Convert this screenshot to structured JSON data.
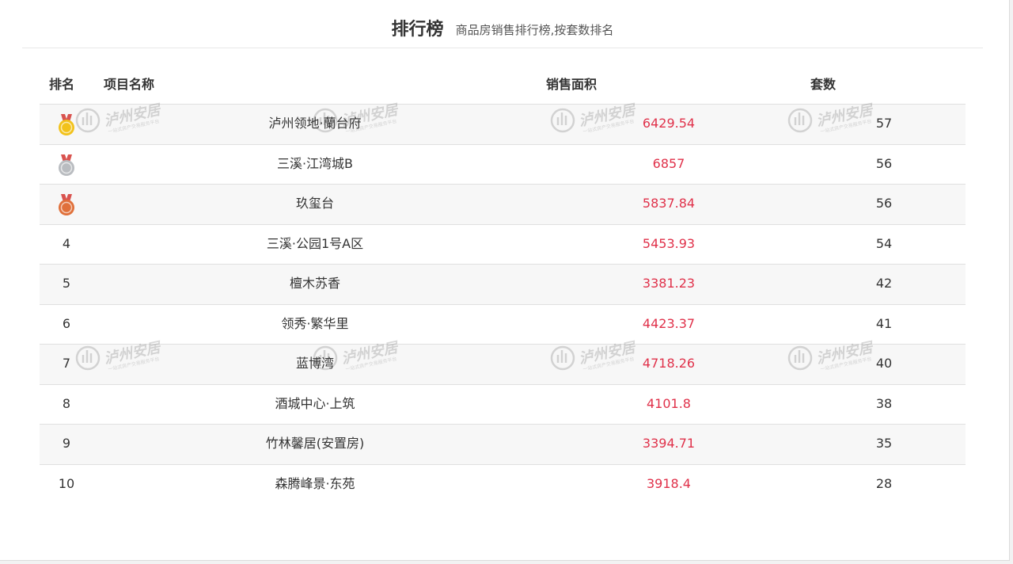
{
  "header": {
    "title": "排行榜",
    "subtitle": "商品房销售排行榜,按套数排名"
  },
  "columns": {
    "rank": "排名",
    "name": "项目名称",
    "area": "销售面积",
    "count": "套数"
  },
  "rows": [
    {
      "rank": "1",
      "medal": "gold-medal-icon",
      "name": "泸州领地·蘭台府",
      "area": "6429.54",
      "count": "57"
    },
    {
      "rank": "2",
      "medal": "silver-medal-icon",
      "name": "三溪·江湾城B",
      "area": "6857",
      "count": "56"
    },
    {
      "rank": "3",
      "medal": "bronze-medal-icon",
      "name": "玖玺台",
      "area": "5837.84",
      "count": "56"
    },
    {
      "rank": "4",
      "name": "三溪·公园1号A区",
      "area": "5453.93",
      "count": "54"
    },
    {
      "rank": "5",
      "name": "檀木苏香",
      "area": "3381.23",
      "count": "42"
    },
    {
      "rank": "6",
      "name": "领秀·繁华里",
      "area": "4423.37",
      "count": "41"
    },
    {
      "rank": "7",
      "name": "蓝博湾",
      "area": "4718.26",
      "count": "40"
    },
    {
      "rank": "8",
      "name": "酒城中心·上筑",
      "area": "4101.8",
      "count": "38"
    },
    {
      "rank": "9",
      "name": "竹林馨居(安置房)",
      "area": "3394.71",
      "count": "35"
    },
    {
      "rank": "10",
      "name": "森腾峰景·东苑",
      "area": "3918.4",
      "count": "28"
    }
  ],
  "watermark": {
    "text": "泸州安居",
    "tagline": "一站式房产交易服务平台"
  },
  "colors": {
    "area_text": "#e0314a",
    "gold": "#f2c21b",
    "silver": "#b9bcc0",
    "bronze": "#e0703a",
    "ribbon": "#d9534f"
  }
}
